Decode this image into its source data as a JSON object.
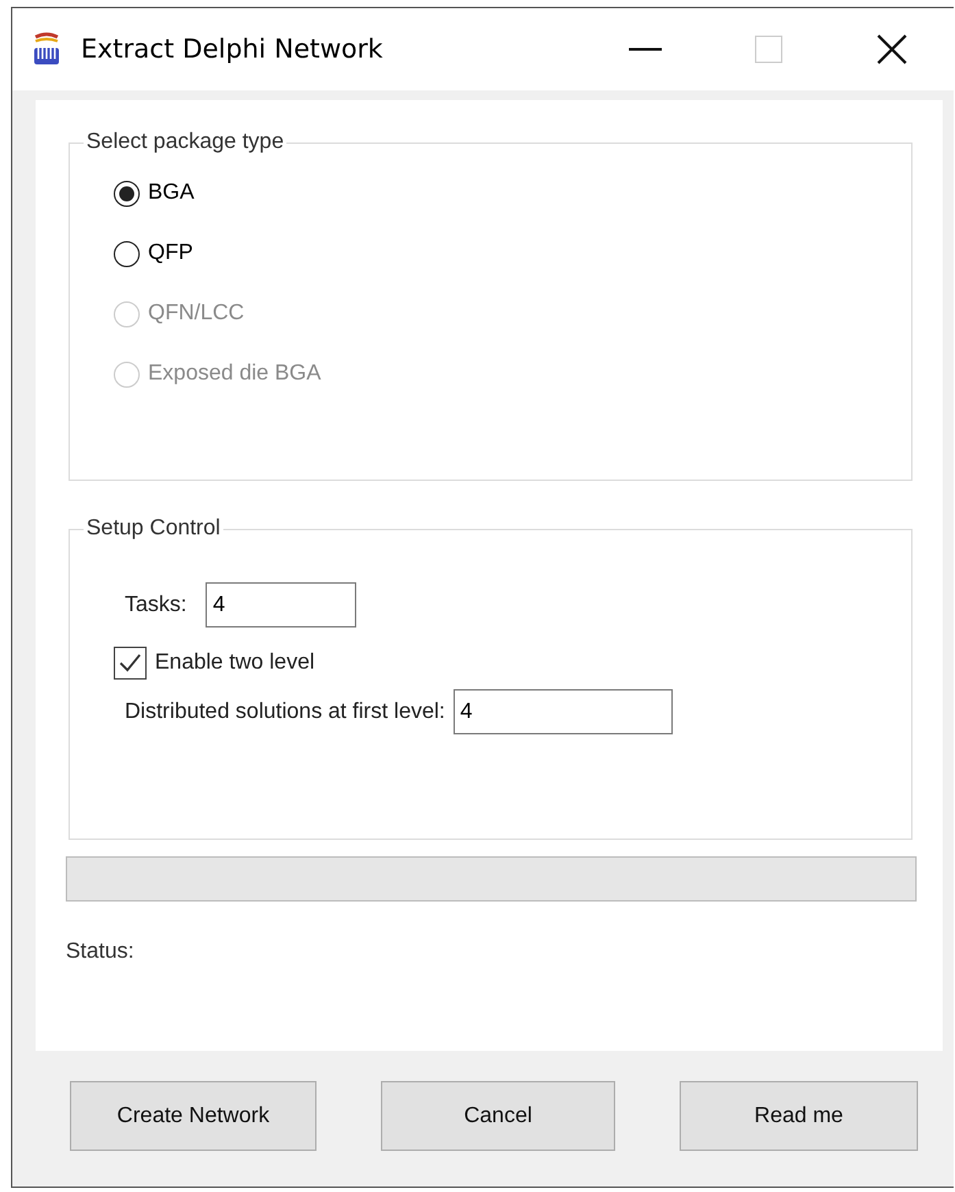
{
  "window": {
    "title": "Extract Delphi Network"
  },
  "package_group": {
    "title": "Select package type",
    "options": [
      {
        "label": "BGA",
        "selected": true,
        "disabled": false
      },
      {
        "label": "QFP",
        "selected": false,
        "disabled": false
      },
      {
        "label": "QFN/LCC",
        "selected": false,
        "disabled": true
      },
      {
        "label": "Exposed die BGA",
        "selected": false,
        "disabled": true
      }
    ]
  },
  "setup_group": {
    "title": "Setup Control",
    "tasks": {
      "label": "Tasks:",
      "value": "4"
    },
    "two_level": {
      "label": "Enable two level",
      "checked": true
    },
    "distributed": {
      "label": "Distributed solutions at first level:",
      "value": "4"
    }
  },
  "status": {
    "label": "Status:"
  },
  "buttons": [
    "Create Network",
    "Cancel",
    "Read me"
  ]
}
